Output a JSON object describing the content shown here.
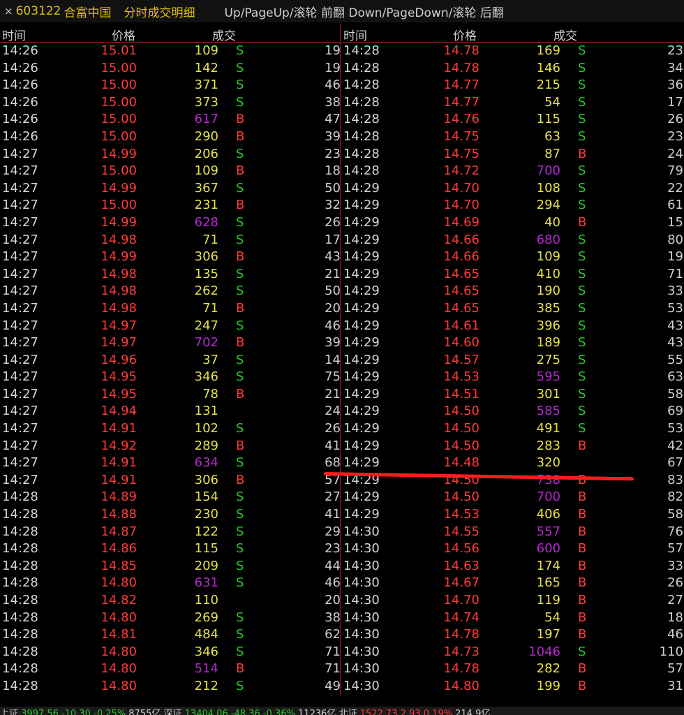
{
  "title": {
    "close": "×",
    "code": "603122",
    "name": "合富中国",
    "mode": "分时成交明细",
    "hint": "Up/PageUp/滚轮 前翻 Down/PageDown/滚轮 后翻"
  },
  "headers": {
    "time": "时间",
    "price": "价格",
    "volume": "成交"
  },
  "left_rows": [
    {
      "time": "14:26",
      "price": "15.01",
      "vol": "109",
      "vc": "y",
      "flag": "S",
      "num": "19"
    },
    {
      "time": "14:26",
      "price": "15.00",
      "vol": "142",
      "vc": "y",
      "flag": "S",
      "num": "19"
    },
    {
      "time": "14:26",
      "price": "15.00",
      "vol": "371",
      "vc": "y",
      "flag": "S",
      "num": "46"
    },
    {
      "time": "14:26",
      "price": "15.00",
      "vol": "373",
      "vc": "y",
      "flag": "S",
      "num": "38"
    },
    {
      "time": "14:26",
      "price": "15.00",
      "vol": "617",
      "vc": "p",
      "flag": "B",
      "num": "47"
    },
    {
      "time": "14:26",
      "price": "15.00",
      "vol": "290",
      "vc": "y",
      "flag": "B",
      "num": "39"
    },
    {
      "time": "14:27",
      "price": "14.99",
      "vol": "206",
      "vc": "y",
      "flag": "S",
      "num": "23"
    },
    {
      "time": "14:27",
      "price": "15.00",
      "vol": "109",
      "vc": "y",
      "flag": "B",
      "num": "18"
    },
    {
      "time": "14:27",
      "price": "14.99",
      "vol": "367",
      "vc": "y",
      "flag": "S",
      "num": "50"
    },
    {
      "time": "14:27",
      "price": "15.00",
      "vol": "231",
      "vc": "y",
      "flag": "B",
      "num": "32"
    },
    {
      "time": "14:27",
      "price": "14.99",
      "vol": "628",
      "vc": "p",
      "flag": "S",
      "num": "26"
    },
    {
      "time": "14:27",
      "price": "14.98",
      "vol": "71",
      "vc": "y",
      "flag": "S",
      "num": "17"
    },
    {
      "time": "14:27",
      "price": "14.99",
      "vol": "306",
      "vc": "y",
      "flag": "B",
      "num": "43"
    },
    {
      "time": "14:27",
      "price": "14.98",
      "vol": "135",
      "vc": "y",
      "flag": "S",
      "num": "21"
    },
    {
      "time": "14:27",
      "price": "14.98",
      "vol": "262",
      "vc": "y",
      "flag": "S",
      "num": "50"
    },
    {
      "time": "14:27",
      "price": "14.98",
      "vol": "71",
      "vc": "y",
      "flag": "B",
      "num": "20"
    },
    {
      "time": "14:27",
      "price": "14.97",
      "vol": "247",
      "vc": "y",
      "flag": "S",
      "num": "46"
    },
    {
      "time": "14:27",
      "price": "14.97",
      "vol": "702",
      "vc": "p",
      "flag": "B",
      "num": "39"
    },
    {
      "time": "14:27",
      "price": "14.96",
      "vol": "37",
      "vc": "y",
      "flag": "S",
      "num": "14"
    },
    {
      "time": "14:27",
      "price": "14.95",
      "vol": "346",
      "vc": "y",
      "flag": "S",
      "num": "75"
    },
    {
      "time": "14:27",
      "price": "14.95",
      "vol": "78",
      "vc": "y",
      "flag": "B",
      "num": "21"
    },
    {
      "time": "14:27",
      "price": "14.94",
      "vol": "131",
      "vc": "y",
      "flag": "",
      "num": "24"
    },
    {
      "time": "14:27",
      "price": "14.91",
      "vol": "102",
      "vc": "y",
      "flag": "S",
      "num": "26"
    },
    {
      "time": "14:27",
      "price": "14.92",
      "vol": "289",
      "vc": "y",
      "flag": "B",
      "num": "41"
    },
    {
      "time": "14:27",
      "price": "14.91",
      "vol": "634",
      "vc": "p",
      "flag": "S",
      "num": "68"
    },
    {
      "time": "14:27",
      "price": "14.91",
      "vol": "306",
      "vc": "y",
      "flag": "B",
      "num": "57"
    },
    {
      "time": "14:28",
      "price": "14.89",
      "vol": "154",
      "vc": "y",
      "flag": "S",
      "num": "27"
    },
    {
      "time": "14:28",
      "price": "14.88",
      "vol": "230",
      "vc": "y",
      "flag": "S",
      "num": "41"
    },
    {
      "time": "14:28",
      "price": "14.87",
      "vol": "122",
      "vc": "y",
      "flag": "S",
      "num": "29"
    },
    {
      "time": "14:28",
      "price": "14.86",
      "vol": "115",
      "vc": "y",
      "flag": "S",
      "num": "23"
    },
    {
      "time": "14:28",
      "price": "14.85",
      "vol": "209",
      "vc": "y",
      "flag": "S",
      "num": "44"
    },
    {
      "time": "14:28",
      "price": "14.80",
      "vol": "631",
      "vc": "p",
      "flag": "S",
      "num": "46"
    },
    {
      "time": "14:28",
      "price": "14.82",
      "vol": "110",
      "vc": "y",
      "flag": "",
      "num": "20"
    },
    {
      "time": "14:28",
      "price": "14.80",
      "vol": "269",
      "vc": "y",
      "flag": "S",
      "num": "38"
    },
    {
      "time": "14:28",
      "price": "14.81",
      "vol": "484",
      "vc": "y",
      "flag": "S",
      "num": "62"
    },
    {
      "time": "14:28",
      "price": "14.80",
      "vol": "346",
      "vc": "y",
      "flag": "S",
      "num": "71"
    },
    {
      "time": "14:28",
      "price": "14.80",
      "vol": "514",
      "vc": "p",
      "flag": "B",
      "num": "71"
    },
    {
      "time": "14:28",
      "price": "14.80",
      "vol": "212",
      "vc": "y",
      "flag": "S",
      "num": "49"
    }
  ],
  "right_rows": [
    {
      "time": "14:28",
      "price": "14.78",
      "vol": "169",
      "vc": "y",
      "flag": "S",
      "num": "23"
    },
    {
      "time": "14:28",
      "price": "14.78",
      "vol": "146",
      "vc": "y",
      "flag": "S",
      "num": "34"
    },
    {
      "time": "14:28",
      "price": "14.77",
      "vol": "215",
      "vc": "y",
      "flag": "S",
      "num": "36"
    },
    {
      "time": "14:28",
      "price": "14.77",
      "vol": "54",
      "vc": "y",
      "flag": "S",
      "num": "17"
    },
    {
      "time": "14:28",
      "price": "14.76",
      "vol": "115",
      "vc": "y",
      "flag": "S",
      "num": "26"
    },
    {
      "time": "14:28",
      "price": "14.75",
      "vol": "63",
      "vc": "y",
      "flag": "S",
      "num": "23"
    },
    {
      "time": "14:28",
      "price": "14.75",
      "vol": "87",
      "vc": "y",
      "flag": "B",
      "num": "24"
    },
    {
      "time": "14:28",
      "price": "14.72",
      "vol": "700",
      "vc": "p",
      "flag": "S",
      "num": "79"
    },
    {
      "time": "14:29",
      "price": "14.70",
      "vol": "108",
      "vc": "y",
      "flag": "S",
      "num": "22"
    },
    {
      "time": "14:29",
      "price": "14.70",
      "vol": "294",
      "vc": "y",
      "flag": "S",
      "num": "61"
    },
    {
      "time": "14:29",
      "price": "14.69",
      "vol": "40",
      "vc": "y",
      "flag": "B",
      "num": "15"
    },
    {
      "time": "14:29",
      "price": "14.66",
      "vol": "680",
      "vc": "p",
      "flag": "S",
      "num": "80"
    },
    {
      "time": "14:29",
      "price": "14.66",
      "vol": "109",
      "vc": "y",
      "flag": "S",
      "num": "19"
    },
    {
      "time": "14:29",
      "price": "14.65",
      "vol": "410",
      "vc": "y",
      "flag": "S",
      "num": "71"
    },
    {
      "time": "14:29",
      "price": "14.65",
      "vol": "190",
      "vc": "y",
      "flag": "S",
      "num": "33"
    },
    {
      "time": "14:29",
      "price": "14.65",
      "vol": "385",
      "vc": "y",
      "flag": "S",
      "num": "53"
    },
    {
      "time": "14:29",
      "price": "14.61",
      "vol": "396",
      "vc": "y",
      "flag": "S",
      "num": "43"
    },
    {
      "time": "14:29",
      "price": "14.60",
      "vol": "189",
      "vc": "y",
      "flag": "S",
      "num": "43"
    },
    {
      "time": "14:29",
      "price": "14.57",
      "vol": "275",
      "vc": "y",
      "flag": "S",
      "num": "55"
    },
    {
      "time": "14:29",
      "price": "14.53",
      "vol": "595",
      "vc": "p",
      "flag": "S",
      "num": "63"
    },
    {
      "time": "14:29",
      "price": "14.51",
      "vol": "301",
      "vc": "y",
      "flag": "S",
      "num": "58"
    },
    {
      "time": "14:29",
      "price": "14.50",
      "vol": "585",
      "vc": "p",
      "flag": "S",
      "num": "69"
    },
    {
      "time": "14:29",
      "price": "14.50",
      "vol": "491",
      "vc": "y",
      "flag": "S",
      "num": "53"
    },
    {
      "time": "14:29",
      "price": "14.50",
      "vol": "283",
      "vc": "y",
      "flag": "B",
      "num": "42"
    },
    {
      "time": "14:29",
      "price": "14.48",
      "vol": "320",
      "vc": "y",
      "flag": "",
      "num": "67"
    },
    {
      "time": "14:29",
      "price": "14.50",
      "vol": "738",
      "vc": "p",
      "flag": "B",
      "num": "83"
    },
    {
      "time": "14:29",
      "price": "14.50",
      "vol": "700",
      "vc": "p",
      "flag": "B",
      "num": "82"
    },
    {
      "time": "14:29",
      "price": "14.53",
      "vol": "406",
      "vc": "y",
      "flag": "B",
      "num": "58"
    },
    {
      "time": "14:30",
      "price": "14.55",
      "vol": "557",
      "vc": "p",
      "flag": "B",
      "num": "76"
    },
    {
      "time": "14:30",
      "price": "14.56",
      "vol": "600",
      "vc": "p",
      "flag": "B",
      "num": "57"
    },
    {
      "time": "14:30",
      "price": "14.63",
      "vol": "174",
      "vc": "y",
      "flag": "B",
      "num": "33"
    },
    {
      "time": "14:30",
      "price": "14.67",
      "vol": "165",
      "vc": "y",
      "flag": "B",
      "num": "26"
    },
    {
      "time": "14:30",
      "price": "14.70",
      "vol": "119",
      "vc": "y",
      "flag": "B",
      "num": "27"
    },
    {
      "time": "14:30",
      "price": "14.74",
      "vol": "54",
      "vc": "y",
      "flag": "B",
      "num": "18"
    },
    {
      "time": "14:30",
      "price": "14.78",
      "vol": "197",
      "vc": "y",
      "flag": "B",
      "num": "46"
    },
    {
      "time": "14:30",
      "price": "14.73",
      "vol": "1046",
      "vc": "p",
      "flag": "S",
      "num": "110"
    },
    {
      "time": "14:30",
      "price": "14.78",
      "vol": "282",
      "vc": "y",
      "flag": "B",
      "num": "57"
    },
    {
      "time": "14:30",
      "price": "14.80",
      "vol": "199",
      "vc": "y",
      "flag": "B",
      "num": "31"
    }
  ],
  "status": {
    "sh_label": "上证",
    "sh_index": "3997.56",
    "sh_change": "-10.30",
    "sh_pct": "-0.25%",
    "sh_amount": "8755亿",
    "sz_label": "深证",
    "sz_index": "13404.06",
    "sz_change": "-48.36",
    "sz_pct": "-0.36%",
    "sz_amount": "11236亿",
    "bj_label": "北证",
    "bj_index": "1522.73",
    "bj_change": "2.93",
    "bj_pct": "0.19%",
    "bj_amount": "214.9亿"
  },
  "colors": {
    "background": "#000000",
    "price": "#ff3b3b",
    "volume_normal": "#e6e24a",
    "volume_large": "#b52ad0",
    "sell_flag": "#2fc42f",
    "buy_flag": "#ff3b3b",
    "title": "#e0c000",
    "annotation_line": "#ff1c1c"
  }
}
